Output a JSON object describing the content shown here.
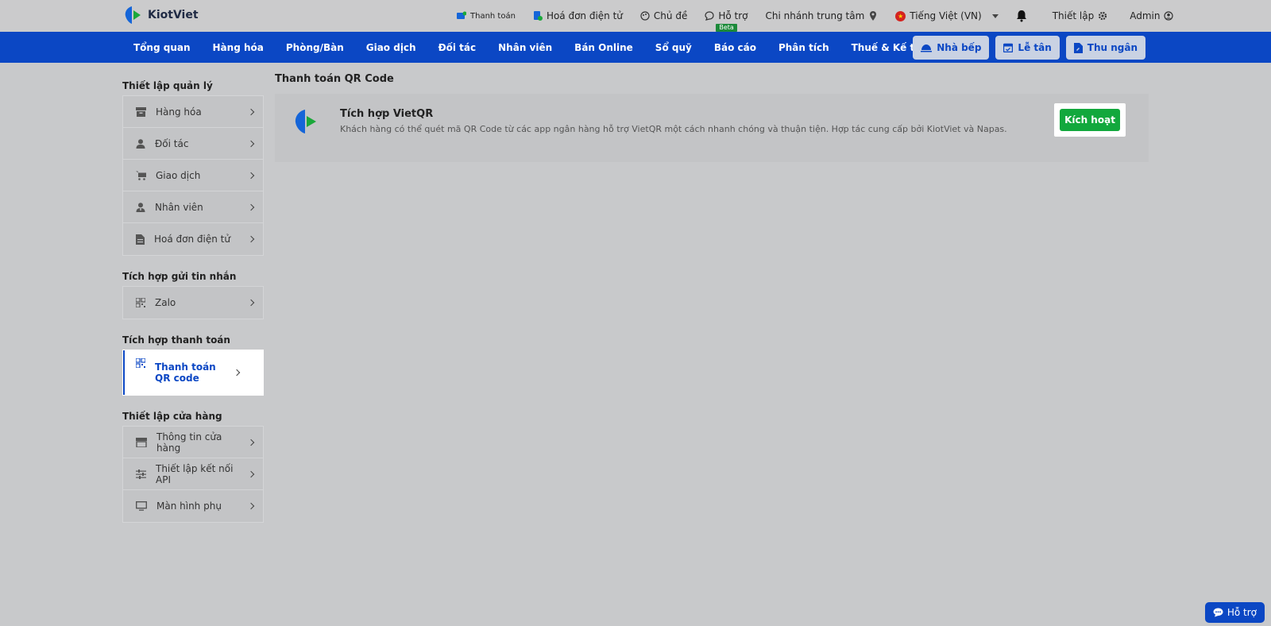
{
  "brand": {
    "name": "KiotViet"
  },
  "top_links": [
    {
      "label": "Thanh toán",
      "icon": "payment-icon"
    },
    {
      "label": "Hoá đơn điện tử",
      "icon": "invoice-icon"
    },
    {
      "label": "Chủ đề",
      "icon": "palette-icon"
    },
    {
      "label": "Hỗ trợ",
      "icon": "chat-icon",
      "badge": "Beta"
    },
    {
      "label": "Chi nhánh trung tâm",
      "icon": "location-icon"
    },
    {
      "label": "Tiếng Việt (VN)",
      "icon": "vn-flag-icon"
    },
    {
      "label": "Thiết lập",
      "icon": "gear-icon"
    },
    {
      "label": "Admin",
      "icon": "user-circle-icon"
    }
  ],
  "nav": {
    "items": [
      "Tổng quan",
      "Hàng hóa",
      "Phòng/Bàn",
      "Giao dịch",
      "Đối tác",
      "Nhân viên",
      "Bán Online",
      "Sổ quỹ",
      "Báo cáo",
      "Phân tích",
      "Thuế & Kế toán"
    ],
    "buttons": [
      {
        "label": "Nhà bếp",
        "icon": "kitchen-icon"
      },
      {
        "label": "Lễ tân",
        "icon": "calendar-icon"
      },
      {
        "label": "Thu ngân",
        "icon": "cashier-icon"
      }
    ]
  },
  "sidebar": {
    "groups": [
      {
        "title": "Thiết lập quản lý",
        "items": [
          "Hàng hóa",
          "Đối tác",
          "Giao dịch",
          "Nhân viên",
          "Hoá đơn điện tử"
        ]
      },
      {
        "title": "Tích hợp gửi tin nhắn",
        "items": [
          "Zalo"
        ]
      },
      {
        "title": "Tích hợp thanh toán",
        "items": [
          "Thanh toán QR code"
        ]
      },
      {
        "title": "Thiết lập cửa hàng",
        "items": [
          "Thông tin cửa hàng",
          "Thiết lập kết nối API",
          "Màn hình phụ"
        ]
      }
    ]
  },
  "main": {
    "title": "Thanh toán QR Code",
    "card": {
      "title": "Tích hợp VietQR",
      "description": "Khách hàng có thể quét mã QR Code từ các app ngân hàng hỗ trợ VietQR một cách nhanh chóng và thuận tiện. Hợp tác cung cấp bởi KiotViet và Napas.",
      "button": "Kích hoạt"
    }
  },
  "help_float": {
    "label": "Hỗ trợ"
  },
  "colors": {
    "primary": "#0b47c4",
    "success": "#12a83d",
    "background": "#c8c9cb"
  }
}
